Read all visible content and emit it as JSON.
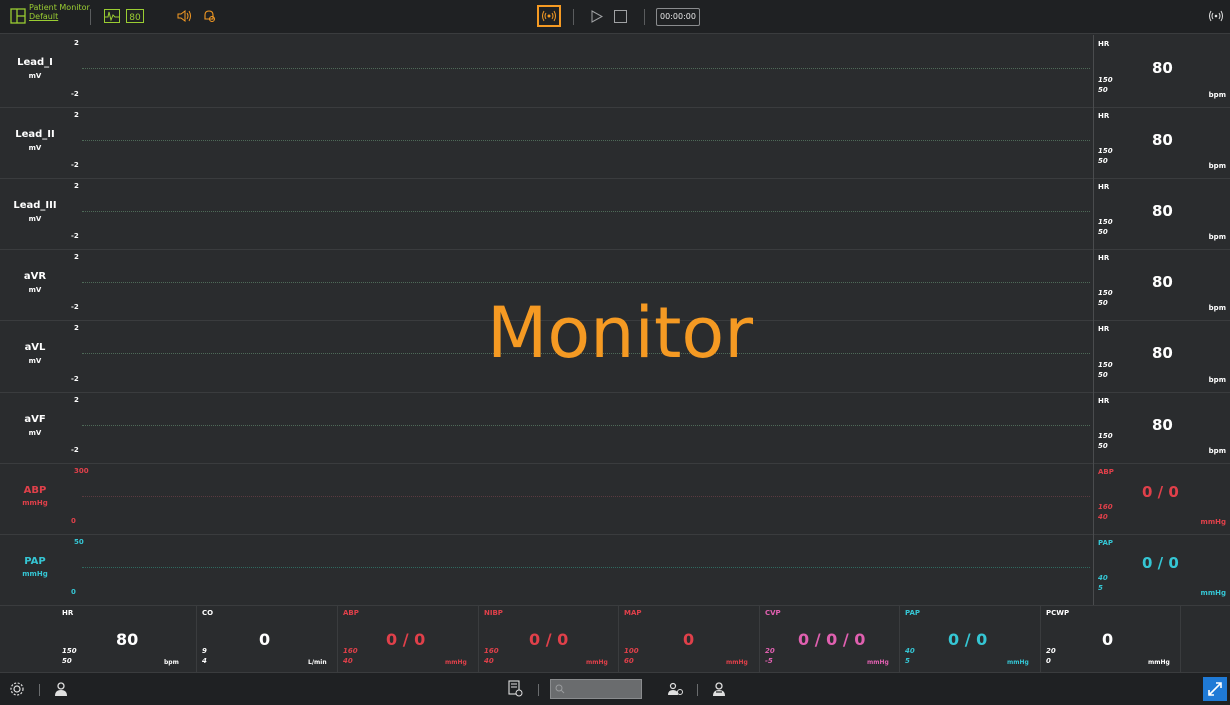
{
  "app": {
    "title": "Patient Monitor",
    "subtitle": "Default",
    "timer": "00:00:00",
    "watermark": "Monitor"
  },
  "colors": {
    "ecg": "#ffffff",
    "abp": "#e0404a",
    "pap": "#35c6d4",
    "nibp": "#e0404a",
    "map": "#e0404a",
    "cvp": "#e060b0",
    "accent": "#f59a23",
    "brand": "#9acd32",
    "expand": "#1f7ad6"
  },
  "icons": {
    "layout": "layout-grid-icon",
    "waveform": "waveform-icon",
    "numeric": "numeric-display-icon",
    "sound": "speaker-icon",
    "alarm": "alarm-bell-icon",
    "record": "broadcast-icon",
    "play": "play-icon",
    "stop": "stop-icon",
    "signal": "signal-icon",
    "settings": "gear-icon",
    "patient": "patient-icon",
    "report": "report-icon",
    "sign": "sign-icon",
    "doctor": "doctor-icon",
    "expand": "expand-icon"
  },
  "waves": [
    {
      "name": "Lead_I",
      "unit": "mV",
      "top": "2",
      "bottom": "-2",
      "color": "#ffffff"
    },
    {
      "name": "Lead_II",
      "unit": "mV",
      "top": "2",
      "bottom": "-2",
      "color": "#ffffff"
    },
    {
      "name": "Lead_III",
      "unit": "mV",
      "top": "2",
      "bottom": "-2",
      "color": "#ffffff"
    },
    {
      "name": "aVR",
      "unit": "mV",
      "top": "2",
      "bottom": "-2",
      "color": "#ffffff"
    },
    {
      "name": "aVL",
      "unit": "mV",
      "top": "2",
      "bottom": "-2",
      "color": "#ffffff"
    },
    {
      "name": "aVF",
      "unit": "mV",
      "top": "2",
      "bottom": "-2",
      "color": "#ffffff"
    },
    {
      "name": "ABP",
      "unit": "mmHg",
      "top": "300",
      "bottom": "0",
      "color": "#e0404a"
    },
    {
      "name": "PAP",
      "unit": "mmHg",
      "top": "50",
      "bottom": "0",
      "color": "#35c6d4"
    }
  ],
  "numerics": [
    {
      "label": "HR",
      "hi": "150",
      "lo": "50",
      "value": "80",
      "unit": "bpm",
      "color": "#ffffff"
    },
    {
      "label": "HR",
      "hi": "150",
      "lo": "50",
      "value": "80",
      "unit": "bpm",
      "color": "#ffffff"
    },
    {
      "label": "HR",
      "hi": "150",
      "lo": "50",
      "value": "80",
      "unit": "bpm",
      "color": "#ffffff"
    },
    {
      "label": "HR",
      "hi": "150",
      "lo": "50",
      "value": "80",
      "unit": "bpm",
      "color": "#ffffff"
    },
    {
      "label": "HR",
      "hi": "150",
      "lo": "50",
      "value": "80",
      "unit": "bpm",
      "color": "#ffffff"
    },
    {
      "label": "HR",
      "hi": "150",
      "lo": "50",
      "value": "80",
      "unit": "bpm",
      "color": "#ffffff"
    },
    {
      "label": "ABP",
      "hi": "160",
      "lo": "40",
      "value": "0 / 0",
      "unit": "mmHg",
      "color": "#e0404a"
    },
    {
      "label": "PAP",
      "hi": "40",
      "lo": "5",
      "value": "0 / 0",
      "unit": "mmHg",
      "color": "#35c6d4"
    }
  ],
  "params": [
    {
      "label": "HR",
      "hi": "150",
      "lo": "50",
      "value": "80",
      "unit": "bpm",
      "color": "#ffffff"
    },
    {
      "label": "CO",
      "hi": "9",
      "lo": "4",
      "value": "0",
      "unit": "L/min",
      "color": "#ffffff"
    },
    {
      "label": "ABP",
      "hi": "160",
      "lo": "40",
      "value": "0 / 0",
      "unit": "mmHg",
      "color": "#e0404a"
    },
    {
      "label": "NIBP",
      "hi": "160",
      "lo": "40",
      "value": "0 / 0",
      "unit": "mmHg",
      "color": "#e0404a"
    },
    {
      "label": "MAP",
      "hi": "100",
      "lo": "60",
      "value": "0",
      "unit": "mmHg",
      "color": "#e0404a"
    },
    {
      "label": "CVP",
      "hi": "20",
      "lo": "-5",
      "value": "0 / 0 / 0",
      "unit": "mmHg",
      "color": "#e060b0"
    },
    {
      "label": "PAP",
      "hi": "40",
      "lo": "5",
      "value": "0 / 0",
      "unit": "mmHg",
      "color": "#35c6d4"
    },
    {
      "label": "PCWP",
      "hi": "20",
      "lo": "0",
      "value": "0",
      "unit": "mmHg",
      "color": "#ffffff"
    }
  ]
}
